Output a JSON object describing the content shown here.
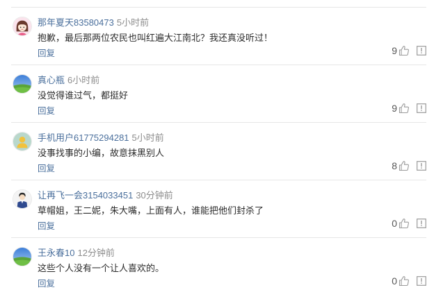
{
  "comments": [
    {
      "user": "那年夏天83580473",
      "time": "5小时前",
      "text": "抱歉，最后那两位农民也叫红遍大江南北？我还真没听过！",
      "reply_label": "回复",
      "likes": "9",
      "avatar": "girl-avatar"
    },
    {
      "user": "真心瓶",
      "time": "6小时前",
      "text": "没觉得谁过气，都挺好",
      "reply_label": "回复",
      "likes": "9",
      "avatar": "landscape-avatar"
    },
    {
      "user": "手机用户61775294281",
      "time": "5小时前",
      "text": "没事找事的小编，故意抹黑别人",
      "reply_label": "回复",
      "likes": "8",
      "avatar": "default-user-avatar"
    },
    {
      "user": "让再飞一会3154033451",
      "time": "30分钟前",
      "text": "草帽姐，王二妮，朱大嘴，上面有人，谁能把他们封杀了",
      "reply_label": "回复",
      "likes": "0",
      "avatar": "cartoon-man-avatar"
    },
    {
      "user": "王永春10",
      "time": "12分钟前",
      "text": "这些个人没有一个让人喜欢的。",
      "reply_label": "回复",
      "likes": "0",
      "avatar": "landscape-avatar"
    }
  ],
  "icons": {
    "like": "thumbs-up-icon",
    "report": "report-icon"
  },
  "colors": {
    "link": "#4a6f9c",
    "time": "#8c8c8c",
    "divider": "#e6e6e6"
  }
}
